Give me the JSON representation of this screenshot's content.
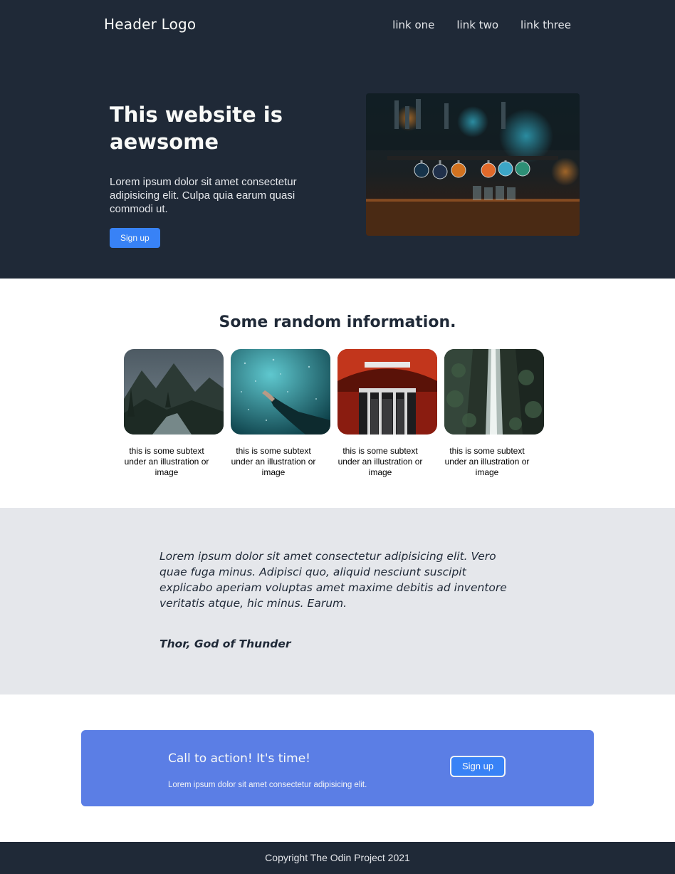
{
  "header": {
    "logo": "Header Logo",
    "links": [
      "link one",
      "link two",
      "link three"
    ]
  },
  "hero": {
    "title": "This website is aewsome",
    "subtitle": "Lorem ipsum dolor sit amet consectetur adipisicing elit. Culpa quia earum quasi commodi ut.",
    "button": "Sign up",
    "image": "bar-taps-photo"
  },
  "info": {
    "title": "Some random information.",
    "cards": [
      {
        "image": "mountain-river-photo",
        "caption": "this is some subtext under an illustration or image"
      },
      {
        "image": "underwater-hand-photo",
        "caption": "this is some subtext under an illustration or image"
      },
      {
        "image": "subway-escalator-photo",
        "caption": "this is some subtext under an illustration or image"
      },
      {
        "image": "forest-waterfall-photo",
        "caption": "this is some subtext under an illustration or image"
      }
    ]
  },
  "quote": {
    "text": "Lorem ipsum dolor sit amet consectetur adipisicing elit. Vero quae fuga minus. Adipisci quo, aliquid nesciunt suscipit explicabo aperiam voluptas amet maxime debitis ad inventore veritatis atque, hic minus. Earum.",
    "author": "Thor, God of Thunder"
  },
  "cta": {
    "title": "Call to action! It's time!",
    "subtitle": "Lorem ipsum dolor sit amet consectetur adipisicing elit.",
    "button": "Sign up"
  },
  "footer": {
    "text": "Copyright The Odin Project 2021"
  },
  "colors": {
    "dark": "#1f2937",
    "light": "#f9faf8",
    "accent": "#3882f6",
    "cta_bg": "#5b7ee5",
    "quote_bg": "#e5e7eb"
  }
}
